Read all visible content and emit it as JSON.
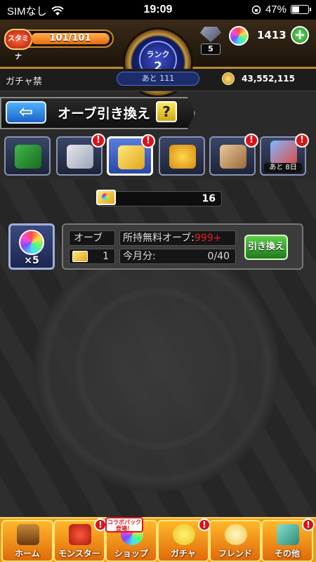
{
  "status_bar": {
    "carrier": "SIMなし",
    "time": "19:09",
    "battery_percent": "47%",
    "battery_level": 0.47
  },
  "header": {
    "stamina_label": "スタミナ",
    "stamina_value": "101/101",
    "stamina_fill": 1.0,
    "rank_label": "ランク",
    "rank_value": "2",
    "gem_count": "5",
    "orb_count": "1413",
    "plus_label": "+"
  },
  "subheader": {
    "gacha_ban": "ガチャ禁",
    "next_rank": "あと 111",
    "gold": "43,552,115"
  },
  "title_bar": {
    "back_label": "⇦",
    "title": "オーブ引き換え",
    "help_label": "?"
  },
  "tabs": [
    {
      "name": "tab-clover",
      "alert": false
    },
    {
      "name": "tab-heart-card",
      "alert": true,
      "alert_label": "!"
    },
    {
      "name": "tab-orb-ticket",
      "alert": true,
      "alert_label": "!",
      "active": true
    },
    {
      "name": "tab-dragon",
      "alert": false
    },
    {
      "name": "tab-castle",
      "alert": true,
      "alert_label": "!"
    },
    {
      "name": "tab-orb-exchange-event",
      "alert": true,
      "alert_label": "!",
      "sub_label": "あと 8日"
    }
  ],
  "main": {
    "ticket_count": "16",
    "reward_qty": "×5",
    "orb_label": "オーブ",
    "free_orb_label": "所持無料オーブ:",
    "free_orb_value": "999+",
    "cost_value": "1",
    "month_label": "今月分:",
    "month_value": "0/40",
    "exchange_label": "引き換え"
  },
  "bottom_nav": [
    {
      "label": "ホーム",
      "alert": false
    },
    {
      "label": "モンスター",
      "alert": true,
      "alert_label": "!"
    },
    {
      "label": "ショップ",
      "alert": false,
      "tag": "コラボパック登場！"
    },
    {
      "label": "ガチャ",
      "alert": true,
      "alert_label": "!"
    },
    {
      "label": "フレンド",
      "alert": false
    },
    {
      "label": "その他",
      "alert": true,
      "alert_label": "!"
    }
  ],
  "colors": {
    "accent_gold": "#b98a2f",
    "alert_red": "#d8141a",
    "exchange_green": "#1e7a1a",
    "nav_orange": "#e7a01a"
  }
}
